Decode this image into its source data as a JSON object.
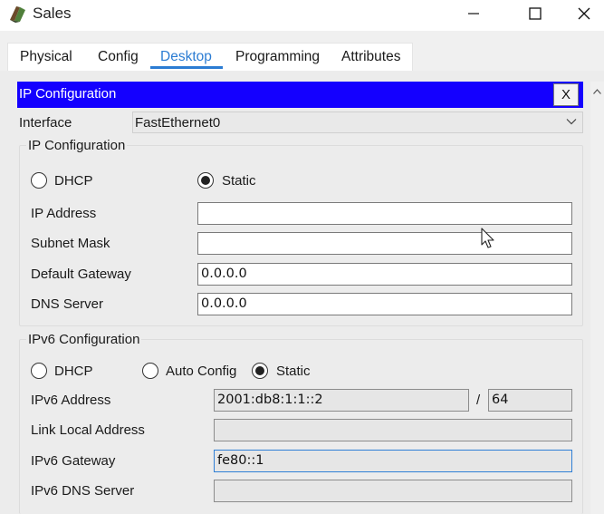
{
  "window": {
    "title": "Sales"
  },
  "tabs": [
    {
      "label": "Physical"
    },
    {
      "label": "Config"
    },
    {
      "label": "Desktop"
    },
    {
      "label": "Programming"
    },
    {
      "label": "Attributes"
    }
  ],
  "active_tab": "Desktop",
  "app_header": {
    "title": "IP Configuration",
    "close_label": "X"
  },
  "interface": {
    "label": "Interface",
    "value": "FastEthernet0"
  },
  "ipv4": {
    "legend": "IP Configuration",
    "dhcp_label": "DHCP",
    "static_label": "Static",
    "selected_mode": "Static",
    "ip_address": {
      "label": "IP Address",
      "value": ""
    },
    "subnet_mask": {
      "label": "Subnet Mask",
      "value": ""
    },
    "default_gateway": {
      "label": "Default Gateway",
      "value": "0.0.0.0"
    },
    "dns_server": {
      "label": "DNS Server",
      "value": "0.0.0.0"
    }
  },
  "ipv6": {
    "legend": "IPv6 Configuration",
    "dhcp_label": "DHCP",
    "auto_config_label": "Auto Config",
    "static_label": "Static",
    "selected_mode": "Static",
    "address": {
      "label": "IPv6 Address",
      "value": "2001:db8:1:1::2",
      "separator": "/",
      "prefix": "64"
    },
    "link_local": {
      "label": "Link Local Address",
      "value": ""
    },
    "gateway": {
      "label": "IPv6 Gateway",
      "value": "fe80::1"
    },
    "dns_server": {
      "label": "IPv6 DNS Server",
      "value": ""
    }
  },
  "colors": {
    "header_bar": "#1400ff",
    "active_tab": "#2b7cd3",
    "panel": "#ececec"
  }
}
